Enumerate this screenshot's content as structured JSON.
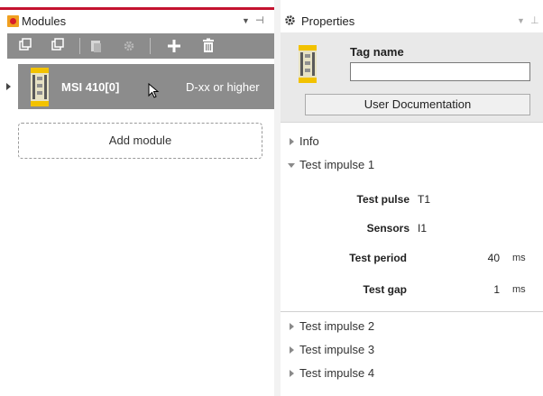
{
  "modules_panel": {
    "title": "Modules",
    "accent_color": "#c4122f",
    "toolbar_buttons": [
      {
        "name": "collapse-all-icon"
      },
      {
        "name": "expand-all-icon"
      },
      {
        "name": "module-settings-icon"
      },
      {
        "name": "gear-icon"
      },
      {
        "name": "add-icon"
      },
      {
        "name": "delete-icon"
      }
    ],
    "module": {
      "name": "MSI 410[0]",
      "version": "D-xx or higher"
    },
    "add_module_label": "Add module"
  },
  "properties_panel": {
    "title": "Properties",
    "tag_name_label": "Tag name",
    "tag_name_value": "",
    "user_doc_button": "User Documentation",
    "sections": {
      "info": "Info",
      "test_impulse_1": "Test impulse 1",
      "test_impulse_2": "Test impulse 2",
      "test_impulse_3": "Test impulse 3",
      "test_impulse_4": "Test impulse 4"
    },
    "test_impulse_1_props": {
      "test_pulse_label": "Test pulse",
      "test_pulse_value": "T1",
      "sensors_label": "Sensors",
      "sensors_value": "I1",
      "test_period_label": "Test period",
      "test_period_value": "40",
      "test_period_unit": "ms",
      "test_gap_label": "Test gap",
      "test_gap_value": "1",
      "test_gap_unit": "ms"
    }
  }
}
